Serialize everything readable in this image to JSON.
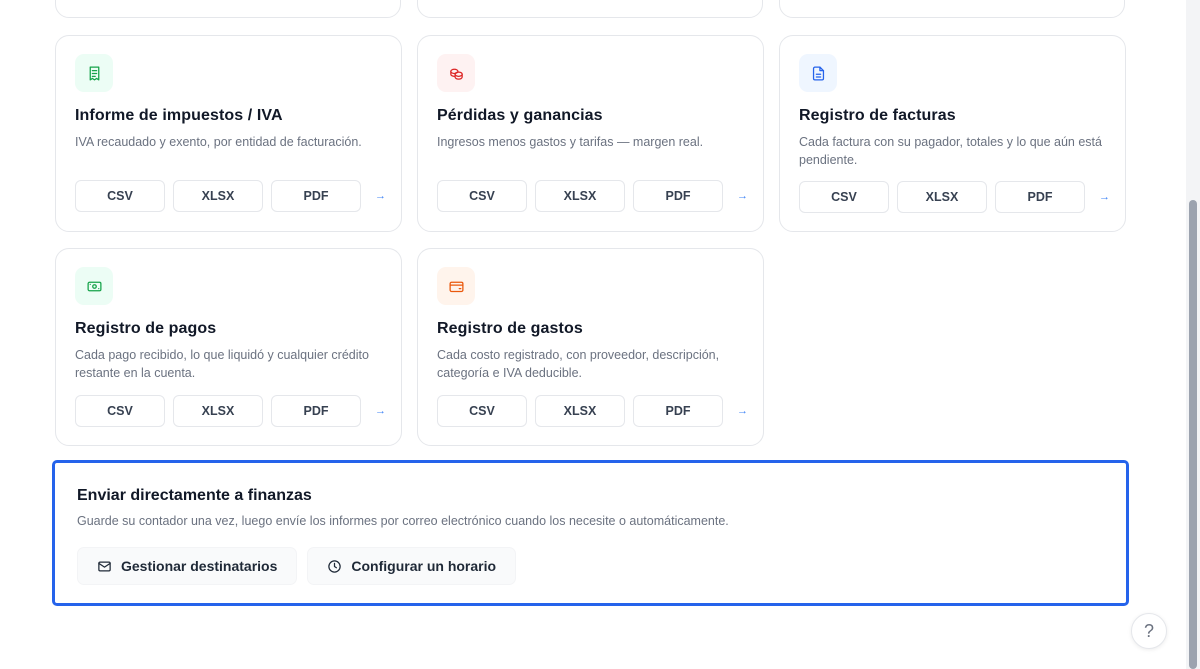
{
  "cards": [
    {
      "title": "Informe de impuestos / IVA",
      "description": "IVA recaudado y exento, por entidad de facturación.",
      "icon": "receipt-icon",
      "color": "#16a34a",
      "buttons": [
        "CSV",
        "XLSX",
        "PDF"
      ]
    },
    {
      "title": "Pérdidas y ganancias",
      "description": "Ingresos menos gastos y tarifas — margen real.",
      "icon": "coins-icon",
      "color": "#dc2626",
      "buttons": [
        "CSV",
        "XLSX",
        "PDF"
      ]
    },
    {
      "title": "Registro de facturas",
      "description": "Cada factura con su pagador, totales y lo que aún está pendiente.",
      "icon": "invoice-icon",
      "color": "#2563eb",
      "buttons": [
        "CSV",
        "XLSX",
        "PDF"
      ]
    },
    {
      "title": "Registro de pagos",
      "description": "Cada pago recibido, lo que liquidó y cualquier crédito restante en la cuenta.",
      "icon": "banknote-icon",
      "color": "#16a34a",
      "buttons": [
        "CSV",
        "XLSX",
        "PDF"
      ]
    },
    {
      "title": "Registro de gastos",
      "description": "Cada costo registrado, con proveedor, descripción, categoría e IVA deducible.",
      "icon": "wallet-icon",
      "color": "#ea580c",
      "buttons": [
        "CSV",
        "XLSX",
        "PDF"
      ]
    }
  ],
  "send": {
    "title": "Enviar directamente a finanzas",
    "description": "Guarde su contador una vez, luego envíe los informes por correo electrónico cuando los necesite o automáticamente.",
    "manage_label": "Gestionar destinatarios",
    "schedule_label": "Configurar un horario"
  },
  "help_label": "?",
  "accent_color": "#2563eb"
}
